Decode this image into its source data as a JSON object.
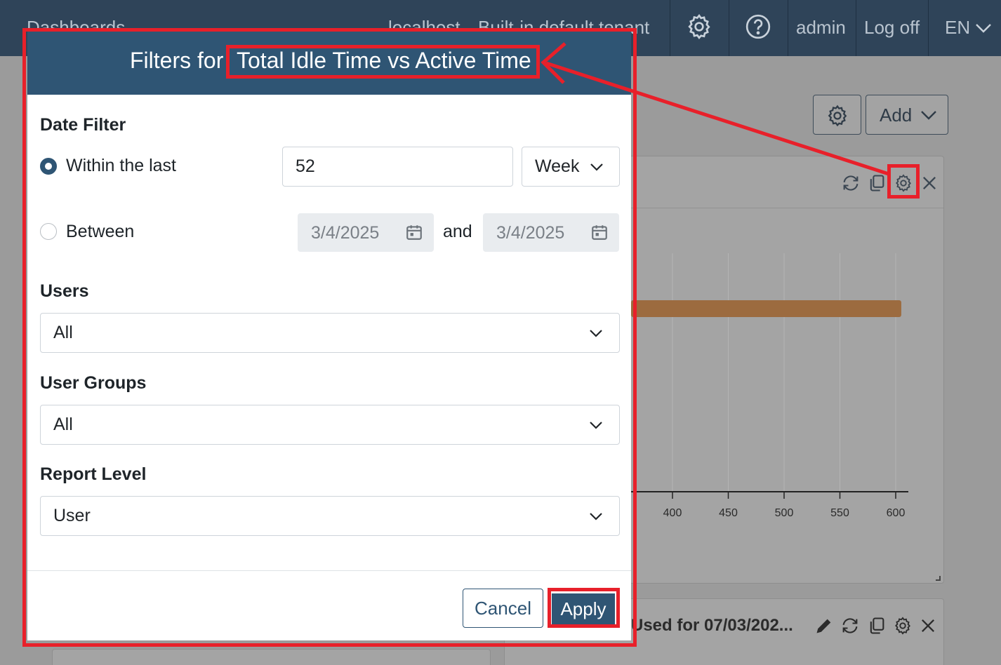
{
  "topbar": {
    "title": "Dashboards",
    "host": "localhost",
    "tenant": "Built-in default tenant",
    "user": "admin",
    "logoff": "Log off",
    "language": "EN",
    "settings_icon": "gear-icon",
    "help_icon": "question-circle-icon"
  },
  "toolbar": {
    "add_label": "Add"
  },
  "widget1": {
    "chart_data": {
      "type": "bar",
      "orientation": "horizontal",
      "x_ticks": [
        400,
        450,
        500,
        550,
        600
      ],
      "values": [
        605
      ],
      "bar_color": "#9c6b3f"
    }
  },
  "widget2": {
    "title": "Used for 07/03/202..."
  },
  "modal": {
    "title_prefix": "Filters for",
    "title_name": "Total Idle Time vs Active Time",
    "date_filter": {
      "label": "Date Filter",
      "within_label": "Within the last",
      "within_value": "52",
      "unit": "Week",
      "between_label": "Between",
      "start_date": "3/4/2025",
      "and_label": "and",
      "end_date": "3/4/2025"
    },
    "users": {
      "label": "Users",
      "value": "All"
    },
    "user_groups": {
      "label": "User Groups",
      "value": "All"
    },
    "report_level": {
      "label": "Report Level",
      "value": "User"
    },
    "cancel_label": "Cancel",
    "apply_label": "Apply"
  },
  "colors": {
    "header": "#2f5574",
    "topbar": "#2f4459",
    "annotation": "#e8202a"
  }
}
